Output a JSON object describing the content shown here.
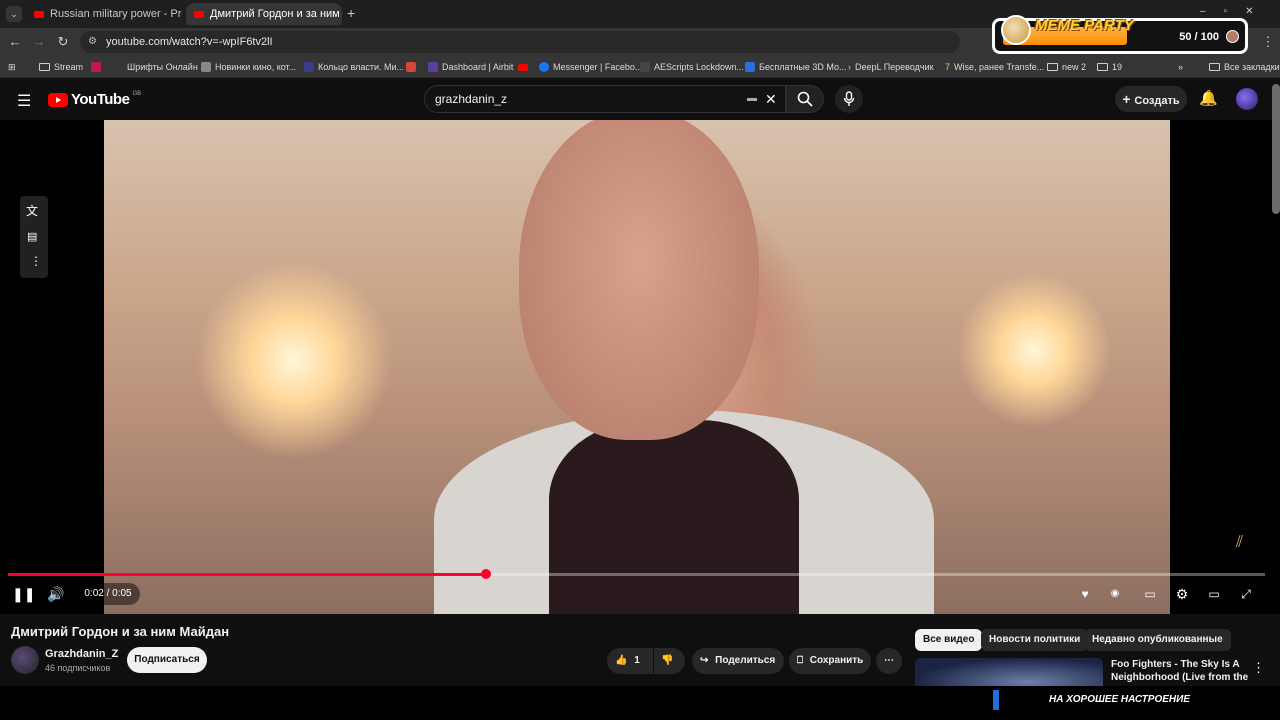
{
  "browser": {
    "tabs": [
      {
        "label": "Russian military power - Prodig"
      },
      {
        "label": "Дмитрий Гордон и за ним"
      }
    ],
    "new_tab": "+",
    "url": "youtube.com/watch?v=-wpIF6tv2lI"
  },
  "bookmarks": [
    {
      "label": "Stream"
    },
    {
      "label": "Шрифты Онлайн"
    },
    {
      "label": "Новинки кино, кот..."
    },
    {
      "label": "Кольцо власти. Ми..."
    },
    {
      "label": "Dashboard | Airbit"
    },
    {
      "label": "Messenger | Facebo..."
    },
    {
      "label": "AEScripts Lockdown..."
    },
    {
      "label": "Бесплатные 3D Мо..."
    },
    {
      "label": "DeepL Переводчик"
    },
    {
      "label": "Wise, ранее Transfe..."
    },
    {
      "label": "new 2"
    },
    {
      "label": "19"
    },
    {
      "label": "Все закладки"
    }
  ],
  "meme_party": {
    "title": "MEME PARTY",
    "count": "50 / 100",
    "progress": 0.5
  },
  "youtube": {
    "logo": "YouTube",
    "country": "GB",
    "search_value": "grazhdanin_z",
    "create_label": "Создать"
  },
  "player": {
    "time": "0:02 / 0:05",
    "progress": 0.38
  },
  "video": {
    "title": "Дмитрий Гордон и за ним Майдан",
    "channel": "Grazhdanin_Z",
    "subscribers": "46 подписчиков",
    "subscribe_label": "Подписаться",
    "likes": "1",
    "share_label": "Поделиться",
    "save_label": "Сохранить"
  },
  "chips": [
    "Все видео",
    "Новости политики",
    "Недавно опубликованные"
  ],
  "recommended": {
    "title": "Foo Fighters - The Sky Is A Neighborhood (Live from the ..."
  },
  "banner": "НА ХОРОШЕЕ НАСТРОЕНИЕ",
  "colors": {
    "accent": "#ff0033",
    "youtube_red": "#ff0000",
    "meme_orange": "#ff8c00"
  }
}
